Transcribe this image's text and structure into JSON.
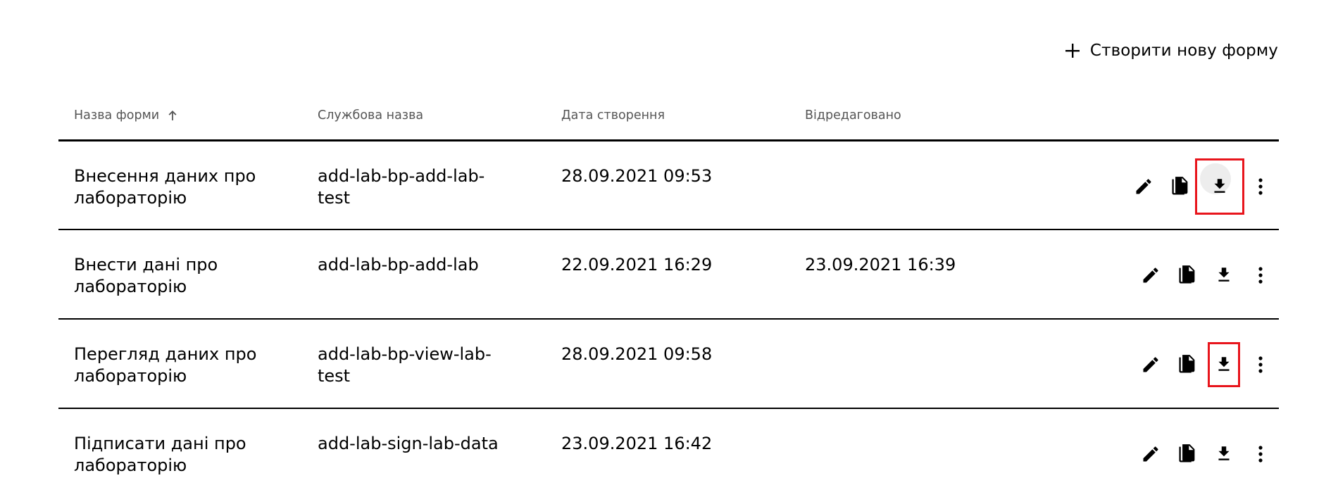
{
  "toolbar": {
    "create_label": "Створити нову форму"
  },
  "table": {
    "headers": [
      "Назва форми",
      "Службова назва",
      "Дата створення",
      "Відредаговано"
    ],
    "rows": [
      {
        "title": "Внесення даних про\nлабораторію",
        "service_name": "add-lab-bp-add-lab-\ntest",
        "created": "28.09.2021 09:53",
        "edited": ""
      },
      {
        "title": "Внести дані про\nлабораторію",
        "service_name": "add-lab-bp-add-lab",
        "created": "22.09.2021 16:29",
        "edited": "23.09.2021 16:39"
      },
      {
        "title": "Перегляд даних про\nлабораторію",
        "service_name": "add-lab-bp-view-lab-\ntest",
        "created": "28.09.2021 09:58",
        "edited": ""
      },
      {
        "title": "Підписати дані про\nлабораторію",
        "service_name": "add-lab-sign-lab-data",
        "created": "23.09.2021 16:42",
        "edited": ""
      }
    ]
  },
  "icons": {
    "create": "plus-icon",
    "sort": "arrow-up-icon",
    "edit": "pencil-icon",
    "copy": "copy-icon",
    "download": "download-icon",
    "more": "more-vertical-icon"
  },
  "colors": {
    "highlight": "#e8151c",
    "header_text": "#555555",
    "hover_bg": "#ededed"
  }
}
